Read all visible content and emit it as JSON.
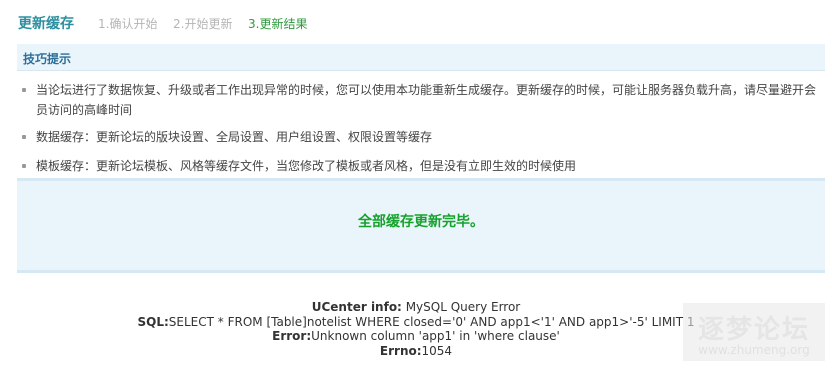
{
  "header": {
    "title": "更新缓存",
    "steps": [
      "1.确认开始",
      "2.开始更新",
      "3.更新结果"
    ]
  },
  "tips": {
    "heading": "技巧提示",
    "items": [
      "当论坛进行了数据恢复、升级或者工作出现异常的时候，您可以使用本功能重新生成缓存。更新缓存的时候，可能让服务器负载升高，请尽量避开会员访问的高峰时间",
      "数据缓存：更新论坛的版块设置、全局设置、用户组设置、权限设置等缓存",
      "模板缓存：更新论坛模板、风格等缓存文件，当您修改了模板或者风格，但是没有立即生效的时候使用"
    ]
  },
  "result": {
    "message": "全部缓存更新完毕。"
  },
  "error": {
    "info_label": "UCenter info:",
    "info_value": "MySQL Query Error",
    "sql_label": "SQL:",
    "sql_value": "SELECT * FROM [Table]notelist WHERE closed='0' AND app1<'1' AND app1>'-5' LIMIT 1",
    "error_label": "Error:",
    "error_value": "Unknown column 'app1' in 'where clause'",
    "errno_label": "Errno:",
    "errno_value": "1054"
  },
  "watermark": {
    "text": "逐梦论坛",
    "url": "www.zhumeng.org"
  },
  "colors": {
    "accent": "#2b8fa0",
    "success": "#15a22c",
    "panel": "#eaf4fb"
  }
}
